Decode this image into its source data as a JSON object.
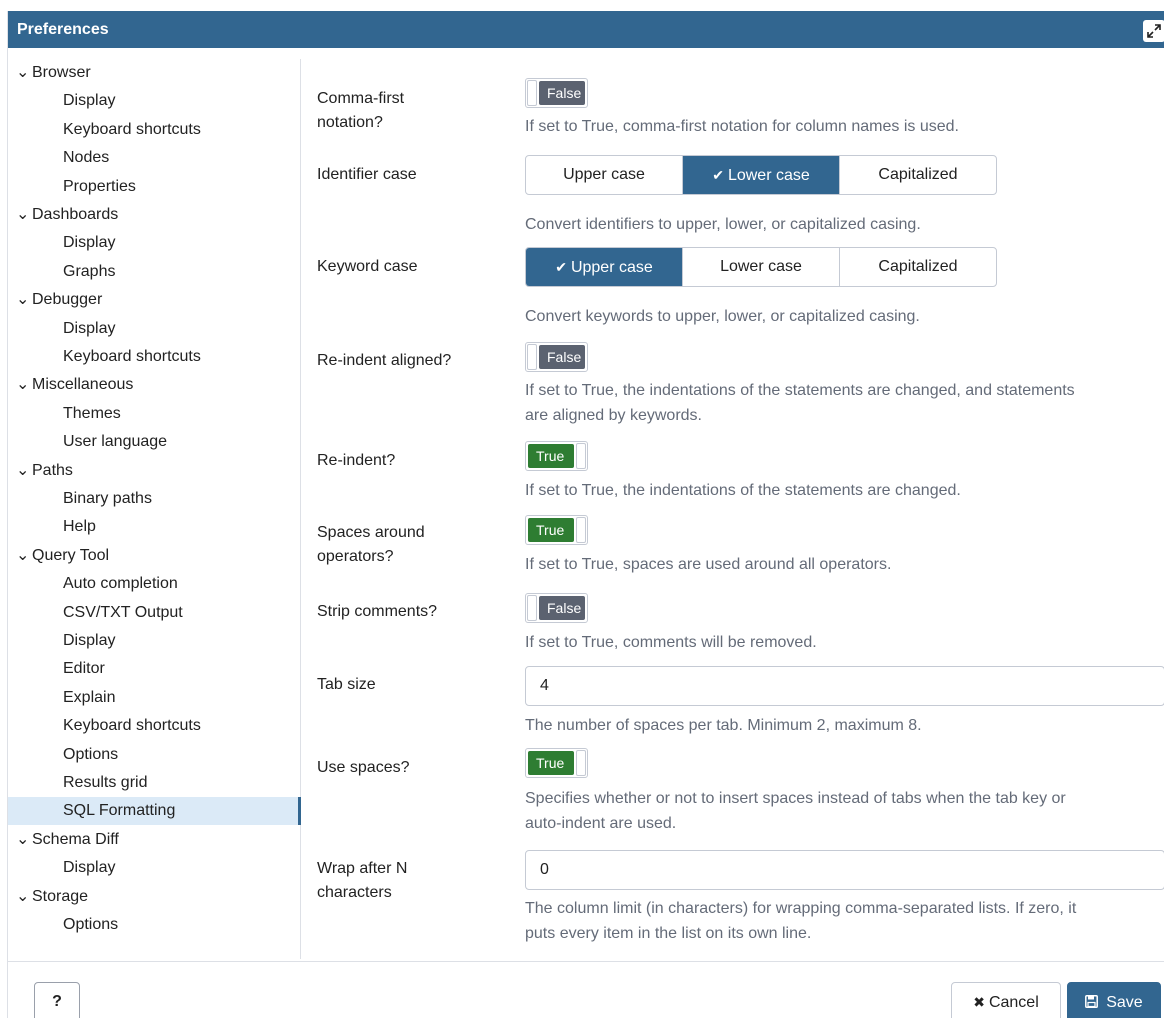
{
  "window": {
    "title": "Preferences"
  },
  "tree": [
    {
      "label": "Browser",
      "type": "group"
    },
    {
      "label": "Display",
      "type": "child"
    },
    {
      "label": "Keyboard shortcuts",
      "type": "child"
    },
    {
      "label": "Nodes",
      "type": "child"
    },
    {
      "label": "Properties",
      "type": "child"
    },
    {
      "label": "Dashboards",
      "type": "group"
    },
    {
      "label": "Display",
      "type": "child"
    },
    {
      "label": "Graphs",
      "type": "child"
    },
    {
      "label": "Debugger",
      "type": "group"
    },
    {
      "label": "Display",
      "type": "child"
    },
    {
      "label": "Keyboard shortcuts",
      "type": "child"
    },
    {
      "label": "Miscellaneous",
      "type": "group"
    },
    {
      "label": "Themes",
      "type": "child"
    },
    {
      "label": "User language",
      "type": "child"
    },
    {
      "label": "Paths",
      "type": "group"
    },
    {
      "label": "Binary paths",
      "type": "child"
    },
    {
      "label": "Help",
      "type": "child"
    },
    {
      "label": "Query Tool",
      "type": "group"
    },
    {
      "label": "Auto completion",
      "type": "child"
    },
    {
      "label": "CSV/TXT Output",
      "type": "child"
    },
    {
      "label": "Display",
      "type": "child"
    },
    {
      "label": "Editor",
      "type": "child"
    },
    {
      "label": "Explain",
      "type": "child"
    },
    {
      "label": "Keyboard shortcuts",
      "type": "child"
    },
    {
      "label": "Options",
      "type": "child"
    },
    {
      "label": "Results grid",
      "type": "child"
    },
    {
      "label": "SQL Formatting",
      "type": "child",
      "active": true
    },
    {
      "label": "Schema Diff",
      "type": "group"
    },
    {
      "label": "Display",
      "type": "child"
    },
    {
      "label": "Storage",
      "type": "group"
    },
    {
      "label": "Options",
      "type": "child"
    }
  ],
  "form": {
    "comma_first": {
      "label_line1": "Comma-first",
      "label_line2": "notation?",
      "value": "False",
      "help": "If set to True, comma-first notation for column names is used."
    },
    "identifier_case": {
      "label": "Identifier case",
      "options": [
        "Upper case",
        "Lower case",
        "Capitalized"
      ],
      "selected": "Lower case",
      "help": "Convert identifiers to upper, lower, or capitalized casing."
    },
    "keyword_case": {
      "label": "Keyword case",
      "options": [
        "Upper case",
        "Lower case",
        "Capitalized"
      ],
      "selected": "Upper case",
      "help": "Convert keywords to upper, lower, or capitalized casing."
    },
    "reindent_aligned": {
      "label": "Re-indent aligned?",
      "value": "False",
      "help_line1": "If set to True, the indentations of the statements are changed, and statements",
      "help_line2": "are aligned by keywords."
    },
    "reindent": {
      "label": "Re-indent?",
      "value": "True",
      "help": "If set to True, the indentations of the statements are changed."
    },
    "spaces_around_operators": {
      "label_line1": "Spaces around",
      "label_line2": "operators?",
      "value": "True",
      "help": "If set to True, spaces are used around all operators."
    },
    "strip_comments": {
      "label": "Strip comments?",
      "value": "False",
      "help": "If set to True, comments will be removed."
    },
    "tab_size": {
      "label": "Tab size",
      "value": "4",
      "help": "The number of spaces per tab. Minimum 2, maximum 8."
    },
    "use_spaces": {
      "label": "Use spaces?",
      "value": "True",
      "help_line1": "Specifies whether or not to insert spaces instead of tabs when the tab key or",
      "help_line2": "auto-indent are used."
    },
    "wrap_after": {
      "label_line1": "Wrap after N",
      "label_line2": "characters",
      "value": "0",
      "help_line1": "The column limit (in characters) for wrapping comma-separated lists. If zero, it",
      "help_line2": "puts every item in the list on its own line."
    }
  },
  "footer": {
    "help_label": "?",
    "cancel_label": "Cancel",
    "save_label": "Save"
  },
  "colors": {
    "accent": "#326690",
    "switch_true": "#2e7d32",
    "switch_false": "#5b6270",
    "active_item_bg": "#dbeaf7"
  },
  "icons": {
    "maximize": "expand-icon",
    "chevron": "chevron-down-icon",
    "check": "check-icon",
    "cancel": "close-icon",
    "save": "floppy-disk-icon"
  }
}
